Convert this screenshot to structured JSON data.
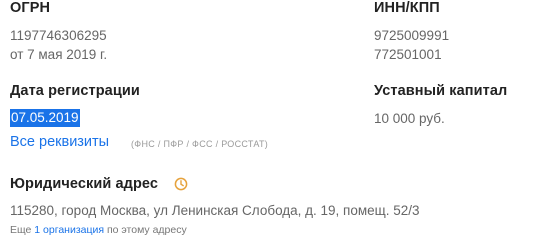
{
  "ogrn": {
    "title": "ОГРН",
    "value": "1197746306295",
    "date": "от 7 мая 2019 г."
  },
  "inn_kpp": {
    "title": "ИНН/КПП",
    "inn": "9725009991",
    "kpp": "772501001"
  },
  "registration": {
    "title": "Дата регистрации",
    "date": "07.05.2019"
  },
  "capital": {
    "title": "Уставный капитал",
    "value": "10 000 руб."
  },
  "requisites": {
    "link_label": "Все реквизиты",
    "note": "(ФНС / ПФР / ФСС / РОССТАТ)"
  },
  "address": {
    "title": "Юридический адрес",
    "icon": "clock-icon",
    "value": "115280, город Москва, ул Ленинская Слобода, д. 19, помещ. 52/3",
    "more_prefix": "Еще ",
    "more_link": "1 организация",
    "more_suffix": " по этому адресу"
  },
  "colors": {
    "accent": "#1a73e8",
    "icon": "#e6a23c",
    "muted": "#9a9a9a"
  }
}
